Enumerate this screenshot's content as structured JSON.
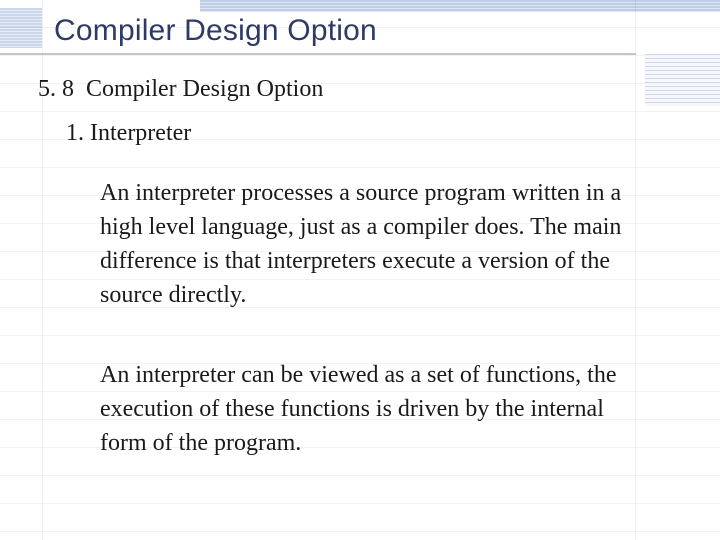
{
  "title": "Compiler Design Option",
  "section": {
    "number": "5. 8",
    "heading": "Compiler Design Option"
  },
  "subsection": {
    "label": "1. Interpreter"
  },
  "paragraphs": {
    "p1": "An interpreter processes a source program written in a high level language, just as a compiler does. The main difference is that interpreters execute a version of the source directly.",
    "p2": "An interpreter can be viewed as a set of functions, the execution of these functions is driven by the internal form of the program."
  },
  "colors": {
    "title": "#2e3a66",
    "band": "#8aa3d1"
  }
}
